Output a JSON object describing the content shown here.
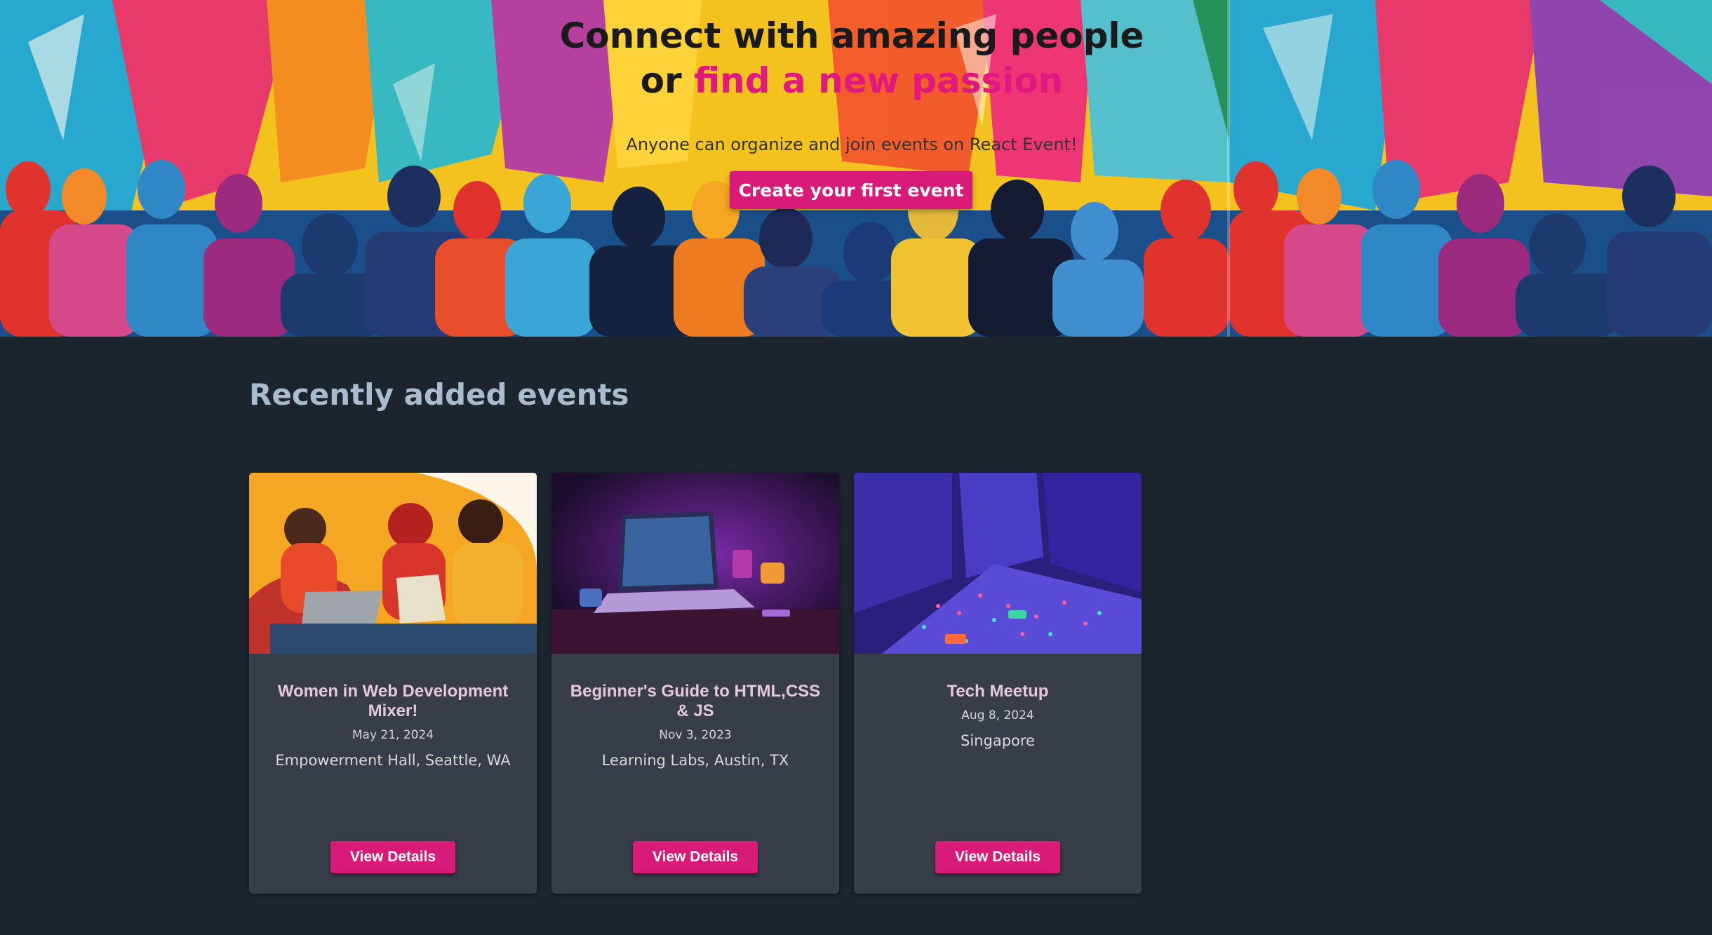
{
  "hero": {
    "headline_line1": "Connect with amazing people",
    "headline_line2_prefix": "or ",
    "headline_line2_accent": "find a new passion",
    "subtitle": "Anyone can organize and join events on React Event!",
    "cta_label": "Create your first event",
    "accent_color": "#e0187f"
  },
  "events_section": {
    "title": "Recently added events",
    "events": [
      {
        "title": "Women in Web Development Mixer!",
        "date": "May 21, 2024",
        "venue": "Empowerment Hall, Seattle, WA",
        "button_label": "View Details"
      },
      {
        "title": "Beginner's Guide to HTML,CSS & JS",
        "date": "Nov 3, 2023",
        "venue": "Learning Labs, Austin, TX",
        "button_label": "View Details"
      },
      {
        "title": "Tech Meetup",
        "date": "Aug 8, 2024",
        "venue": "Singapore",
        "button_label": "View Details"
      }
    ]
  },
  "colors": {
    "page_background": "#1c242e",
    "card_background": "#383e47",
    "button_pink": "#d81b78",
    "section_title": "#a9bccd"
  }
}
